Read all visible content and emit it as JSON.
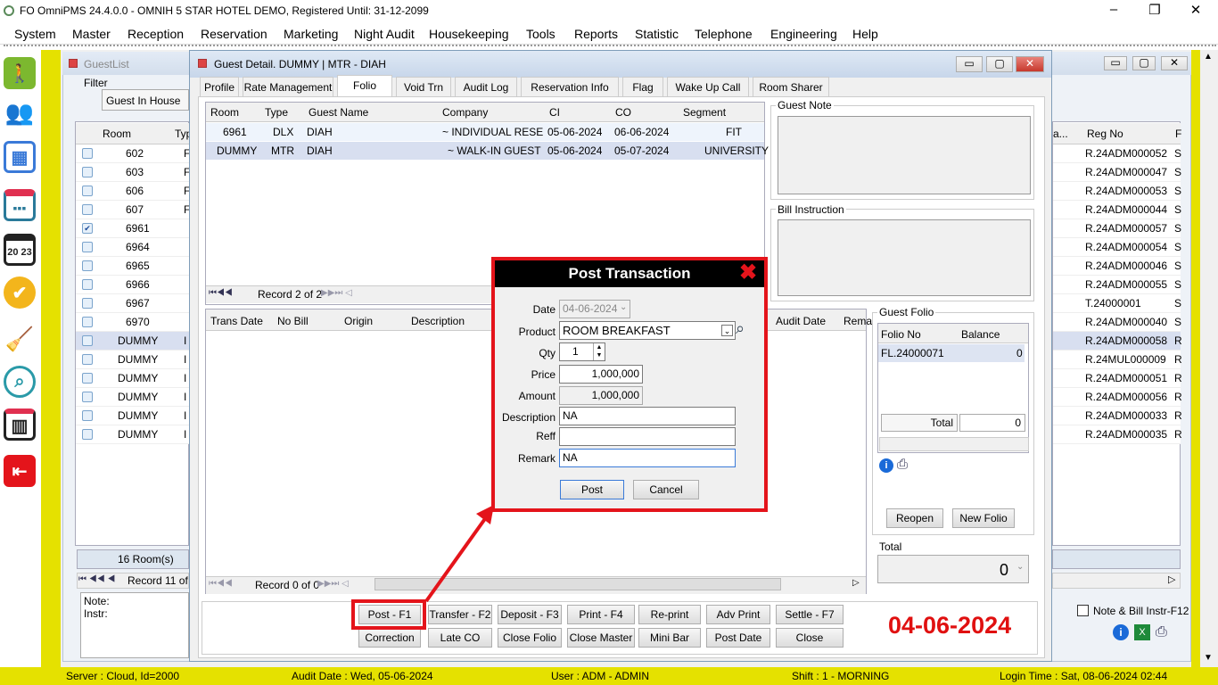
{
  "app": {
    "title": "FO OmniPMS 24.4.0.0 - OMNIH 5 STAR HOTEL DEMO, Registered Until: 31-12-2099",
    "min": "–",
    "max": "❐",
    "close": "✕"
  },
  "menu": [
    "System",
    "Master",
    "Reception",
    "Reservation",
    "Marketing",
    "Night Audit",
    "Housekeeping",
    "Tools",
    "Reports",
    "Statistic",
    "Telephone",
    "Engineering",
    "Help"
  ],
  "sidebar_icons": [
    "walk-in-icon",
    "users-icon",
    "floorplan-icon",
    "calendar-icon",
    "calendar-2023-icon",
    "badge-check-icon",
    "cleaning-icon",
    "search-chart-icon",
    "bar-chart-icon",
    "exit-icon"
  ],
  "calendar_text": "20 23",
  "guestlist": {
    "title": "GuestList",
    "filter_label": "Filter",
    "filter_value": "Guest In House",
    "col_room": "Room",
    "col_type": "Typ",
    "rooms": [
      "602",
      "603",
      "606",
      "607",
      "6961",
      "6964",
      "6965",
      "6966",
      "6967",
      "6970",
      "DUMMY",
      "DUMMY",
      "DUMMY",
      "DUMMY",
      "DUMMY",
      "DUMMY"
    ],
    "type_chars": [
      "F",
      "F",
      "F",
      "F",
      "",
      "",
      "",
      "",
      "",
      "",
      "I",
      "I",
      "I",
      "I",
      "I",
      "I"
    ],
    "checked_row": 4,
    "selected_row": 10,
    "room_count": "16 Room(s)",
    "record": "Record 11 of",
    "note_label": "Note:",
    "instr_label": "Instr:",
    "col_a": "a...",
    "col_reg": "Reg No",
    "col_s": "F",
    "regnos": [
      "R.24ADM000052",
      "R.24ADM000047",
      "R.24ADM000053",
      "R.24ADM000044",
      "R.24ADM000057",
      "R.24ADM000054",
      "R.24ADM000046",
      "R.24ADM000055",
      "T.24000001",
      "R.24ADM000040",
      "R.24ADM000058",
      "R.24MUL000009",
      "R.24ADM000051",
      "R.24ADM000056",
      "R.24ADM000033",
      "R.24ADM000035"
    ],
    "s_col": [
      "S",
      "S",
      "S",
      "S",
      "S",
      "S",
      "S",
      "S",
      "S",
      "S",
      "R",
      "R",
      "R",
      "R",
      "R",
      "R"
    ],
    "note_bill": "Note & Bill Instr-F12"
  },
  "guestdetail": {
    "title": "Guest Detail. DUMMY | MTR - DIAH",
    "tabs": [
      "Profile",
      "Rate Management",
      "Folio",
      "Void Trn",
      "Audit Log",
      "Reservation Info",
      "Flag",
      "Wake Up Call",
      "Room Sharer"
    ],
    "active_tab": "Folio",
    "cols": [
      "Room",
      "Type",
      "Guest Name",
      "Company",
      "CI",
      "CO",
      "Segment"
    ],
    "rows": [
      [
        "6961",
        "DLX",
        "DIAH",
        "~ INDIVIDUAL RESE...",
        "05-06-2024",
        "06-06-2024",
        "FIT"
      ],
      [
        "DUMMY",
        "MTR",
        "DIAH",
        "~ WALK-IN GUEST ~",
        "05-06-2024",
        "05-07-2024",
        "UNIVERSITY"
      ]
    ],
    "record_top": "Record 2 of 2",
    "trans_cols": [
      "Trans Date",
      "No Bill",
      "Origin",
      "Description",
      "Audit Date",
      "Rema"
    ],
    "record_bottom": "Record 0 of 0",
    "guest_note": "Guest Note",
    "bill_instruction": "Bill Instruction",
    "guest_folio": "Guest Folio",
    "folio_cols": [
      "Folio No",
      "Balance"
    ],
    "folio_row": [
      "FL.24000071",
      "0"
    ],
    "total_label": "Total",
    "total_value": "0",
    "reopen": "Reopen",
    "new_folio": "New Folio",
    "total2_label": "Total",
    "total2_value": "0",
    "buttons_row1": [
      "Post - F1",
      "Transfer - F2",
      "Deposit - F3",
      "Print - F4",
      "Re-print",
      "Adv Print",
      "Settle - F7"
    ],
    "buttons_row2": [
      "Correction",
      "Late CO",
      "Close Folio",
      "Close Master",
      "Mini Bar",
      "Post Date",
      "Close"
    ],
    "date_big": "04-06-2024"
  },
  "dialog": {
    "title": "Post Transaction",
    "date_label": "Date",
    "date": "04-06-2024",
    "product_label": "Product",
    "product": "ROOM BREAKFAST",
    "qty_label": "Qty",
    "qty": "1",
    "price_label": "Price",
    "price": "1,000,000",
    "amount_label": "Amount",
    "amount": "1,000,000",
    "desc_label": "Description",
    "desc": "NA",
    "reff_label": "Reff",
    "reff": "",
    "remark_label": "Remark",
    "remark": "NA",
    "post": "Post",
    "cancel": "Cancel"
  },
  "status": {
    "server": "Server : Cloud, Id=2000",
    "audit": "Audit Date : Wed, 05-06-2024",
    "user": "User : ADM - ADMIN",
    "shift": "Shift : 1 - MORNING",
    "login": "Login Time : Sat, 08-06-2024 02:44"
  },
  "colors": {
    "accent_red": "#e4141b",
    "status_yellow": "#e5e100"
  }
}
